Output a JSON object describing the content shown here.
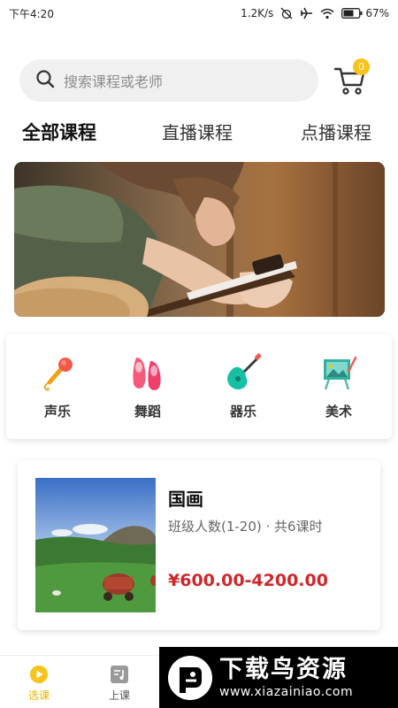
{
  "status_bar": {
    "time": "下午4:20",
    "speed": "1.2K/s",
    "battery": "67"
  },
  "search": {
    "placeholder": "搜索课程或老师",
    "cart_count": "0"
  },
  "tabs": [
    {
      "label": "全部课程",
      "active": true
    },
    {
      "label": "直播课程",
      "active": false
    },
    {
      "label": "点播课程",
      "active": false
    }
  ],
  "categories": [
    {
      "label": "声乐",
      "icon": "microphone-icon"
    },
    {
      "label": "舞蹈",
      "icon": "ballet-shoes-icon"
    },
    {
      "label": "器乐",
      "icon": "guitar-icon"
    },
    {
      "label": "美术",
      "icon": "easel-icon"
    }
  ],
  "course": {
    "title": "国画",
    "info": "班级人数(1-20) · 共6课时",
    "price": "¥600.00-4200.00"
  },
  "bottom_nav": [
    {
      "label": "选课",
      "active": true
    },
    {
      "label": "上课",
      "active": false
    }
  ],
  "watermark": {
    "title": "下载鸟资源",
    "url": "www.xiazainiao.com"
  },
  "colors": {
    "accent": "#f7c31d",
    "price": "#d0262b",
    "tab_highlight": "#f7cf3d"
  }
}
